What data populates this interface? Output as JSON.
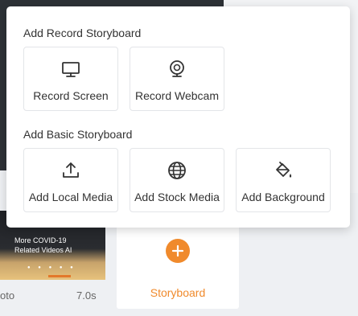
{
  "popover": {
    "record_section_title": "Add Record Storyboard",
    "record_options": [
      {
        "label": "Record Screen",
        "icon": "monitor-icon"
      },
      {
        "label": "Record Webcam",
        "icon": "webcam-icon"
      }
    ],
    "basic_section_title": "Add Basic Storyboard",
    "basic_options": [
      {
        "label": "Add Local Media",
        "icon": "upload-icon"
      },
      {
        "label": "Add Stock Media",
        "icon": "globe-icon"
      },
      {
        "label": "Add Background",
        "icon": "paint-bucket-icon"
      }
    ]
  },
  "timeline": {
    "media_card": {
      "text_line1": "More COVID-19",
      "text_line2": "Related Videos AI",
      "label": "oto",
      "duration": "7.0s"
    },
    "storyboard_card": {
      "label": "Storyboard"
    }
  },
  "colors": {
    "accent": "#f08a2c"
  }
}
